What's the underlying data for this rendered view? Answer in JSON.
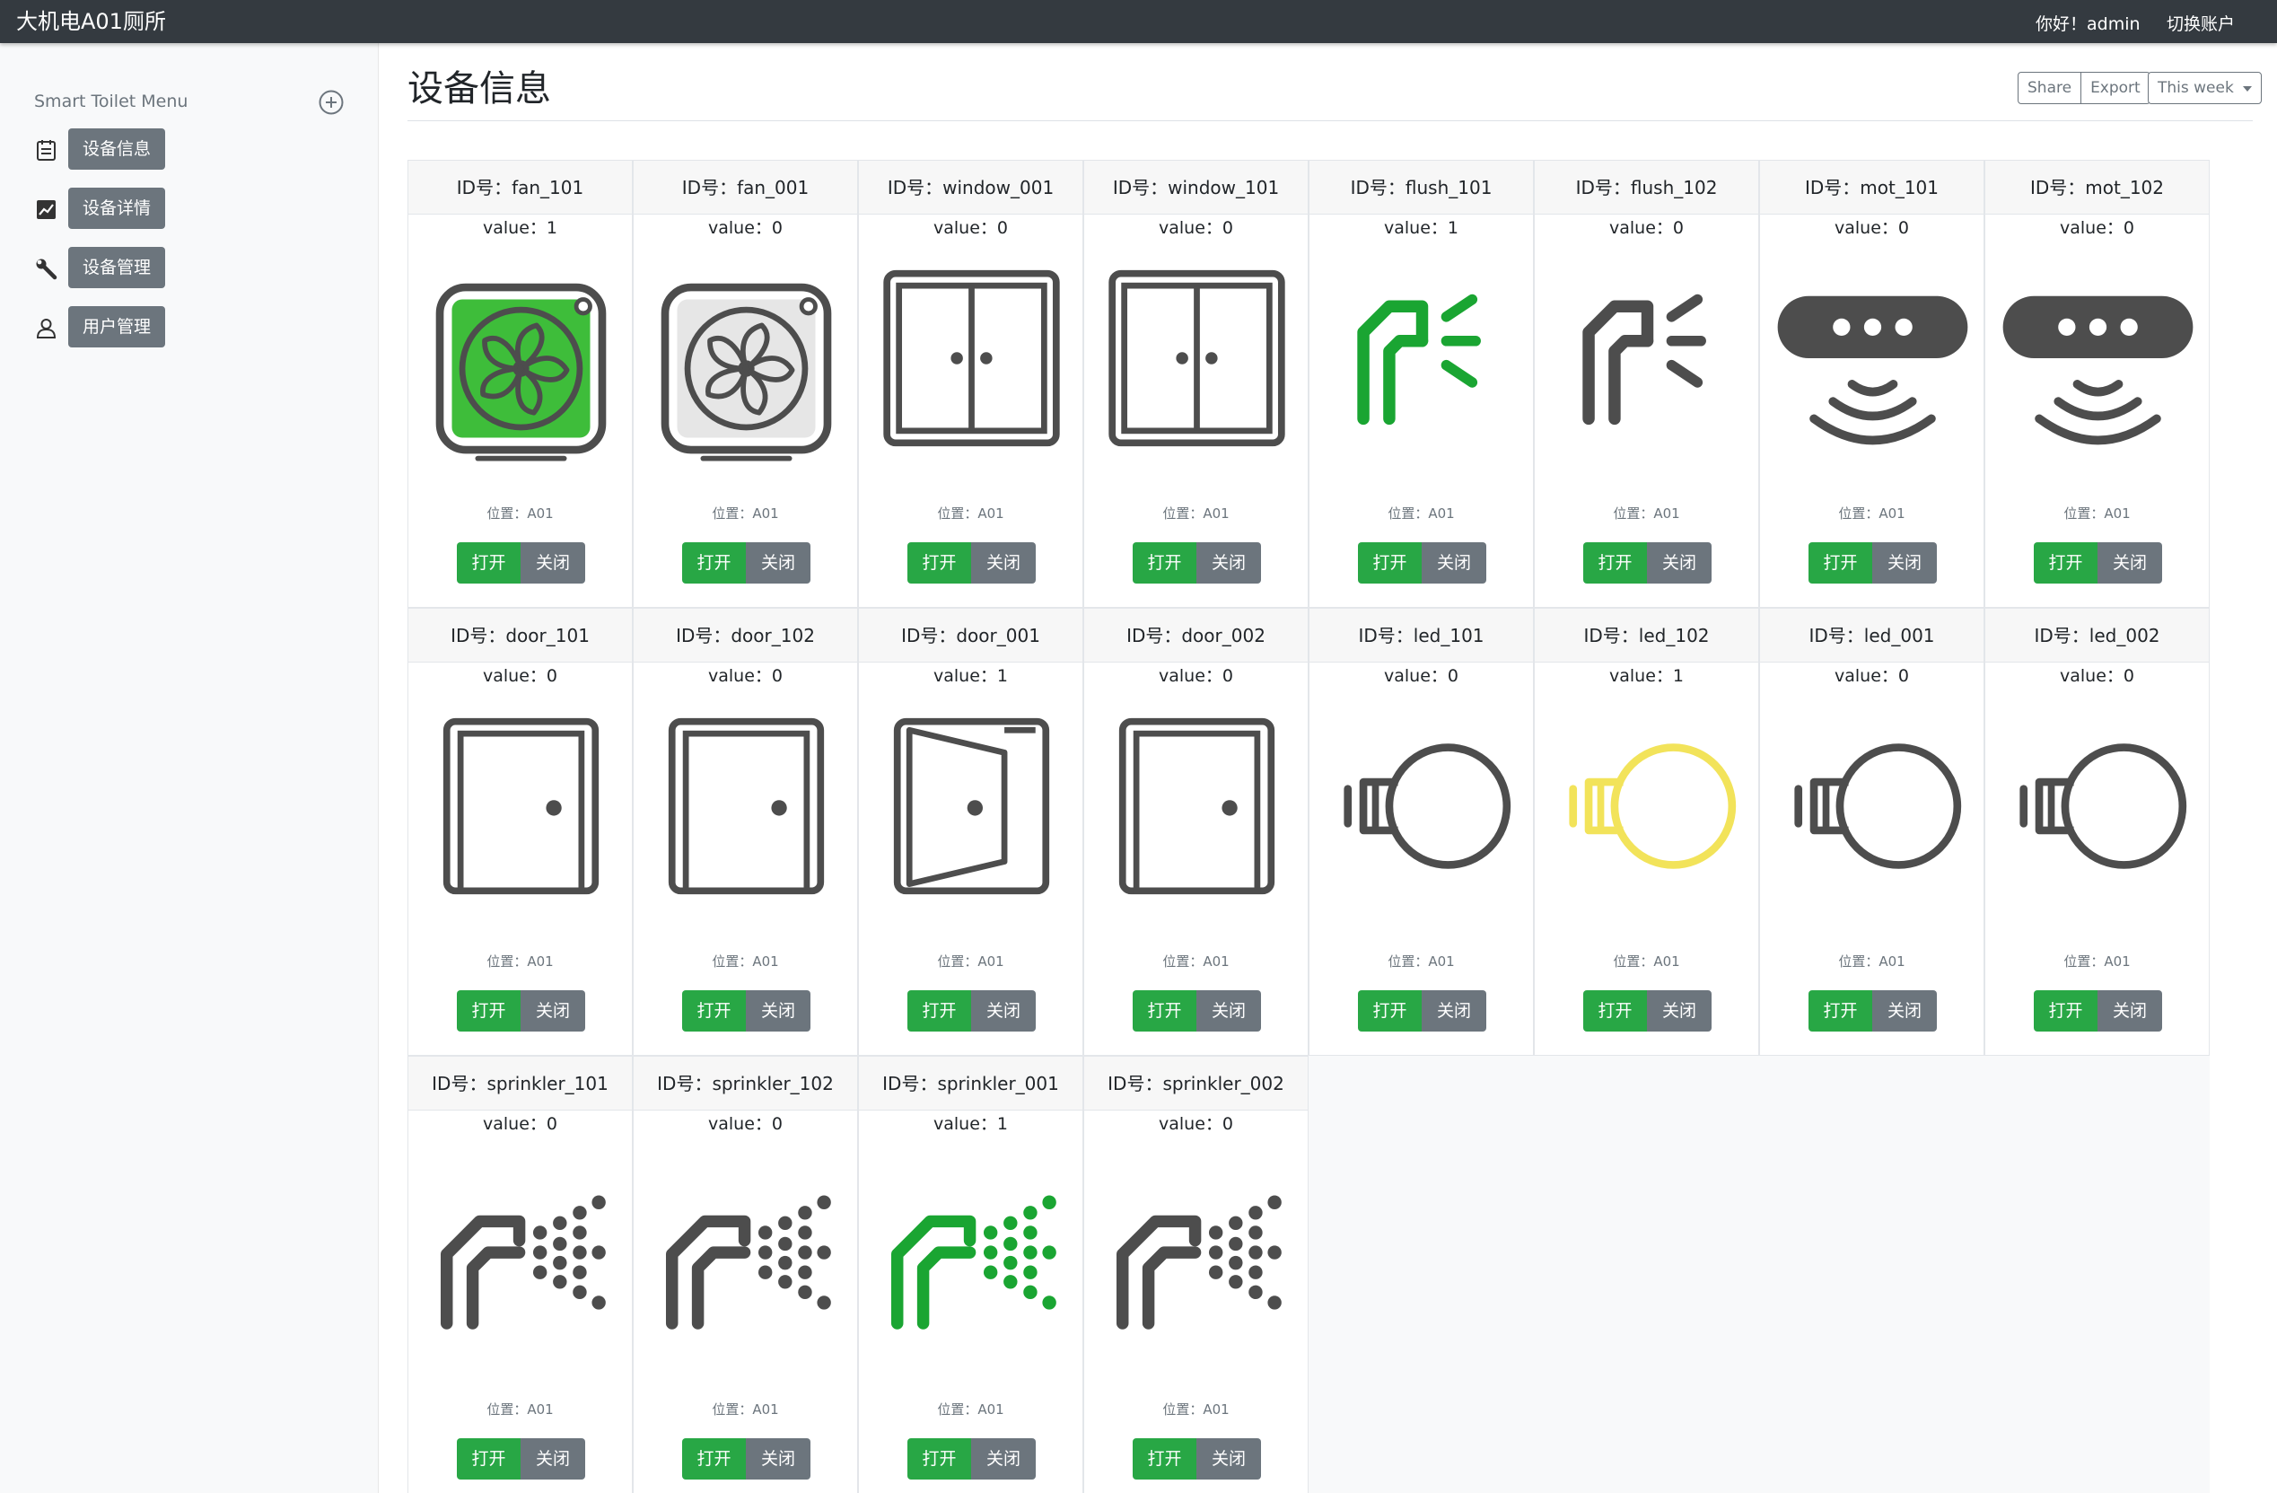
{
  "app": {
    "title": "大机电A01厕所"
  },
  "header": {
    "greeting": "你好！admin",
    "switch_account": "切换账户"
  },
  "sidebar": {
    "title": "Smart Toilet Menu",
    "add_icon": "plus-circle-icon",
    "items": [
      {
        "label": "设备信息",
        "icon": "calendar-icon"
      },
      {
        "label": "设备详情",
        "icon": "chart-icon"
      },
      {
        "label": "设备管理",
        "icon": "wrench-icon"
      },
      {
        "label": "用户管理",
        "icon": "user-icon"
      }
    ]
  },
  "main": {
    "title": "设备信息",
    "share_label": "Share",
    "export_label": "Export",
    "range_label": "This week"
  },
  "colors": {
    "active_green": "#1aa532",
    "led_yellow": "#f2e35a",
    "icon_gray": "#4d4d4d",
    "button_green": "#28a745",
    "button_gray": "#6c757d"
  },
  "devices": [
    {
      "id": "ID号：fan_101",
      "value": "value：1",
      "location": "位置：A01",
      "type": "fan",
      "on_label": "打开",
      "off_label": "关闭"
    },
    {
      "id": "ID号：fan_001",
      "value": "value：0",
      "location": "位置：A01",
      "type": "fan",
      "on_label": "打开",
      "off_label": "关闭"
    },
    {
      "id": "ID号：window_001",
      "value": "value：0",
      "location": "位置：A01",
      "type": "window",
      "on_label": "打开",
      "off_label": "关闭"
    },
    {
      "id": "ID号：window_101",
      "value": "value：0",
      "location": "位置：A01",
      "type": "window",
      "on_label": "打开",
      "off_label": "关闭"
    },
    {
      "id": "ID号：flush_101",
      "value": "value：1",
      "location": "位置：A01",
      "type": "flush",
      "on_label": "打开",
      "off_label": "关闭"
    },
    {
      "id": "ID号：flush_102",
      "value": "value：0",
      "location": "位置：A01",
      "type": "flush",
      "on_label": "打开",
      "off_label": "关闭"
    },
    {
      "id": "ID号：mot_101",
      "value": "value：0",
      "location": "位置：A01",
      "type": "motion",
      "on_label": "打开",
      "off_label": "关闭"
    },
    {
      "id": "ID号：mot_102",
      "value": "value：0",
      "location": "位置：A01",
      "type": "motion",
      "on_label": "打开",
      "off_label": "关闭"
    },
    {
      "id": "ID号：door_101",
      "value": "value：0",
      "location": "位置：A01",
      "type": "door",
      "on_label": "打开",
      "off_label": "关闭"
    },
    {
      "id": "ID号：door_102",
      "value": "value：0",
      "location": "位置：A01",
      "type": "door",
      "on_label": "打开",
      "off_label": "关闭"
    },
    {
      "id": "ID号：door_001",
      "value": "value：1",
      "location": "位置：A01",
      "type": "door",
      "on_label": "打开",
      "off_label": "关闭"
    },
    {
      "id": "ID号：door_002",
      "value": "value：0",
      "location": "位置：A01",
      "type": "door",
      "on_label": "打开",
      "off_label": "关闭"
    },
    {
      "id": "ID号：led_101",
      "value": "value：0",
      "location": "位置：A01",
      "type": "led",
      "on_label": "打开",
      "off_label": "关闭"
    },
    {
      "id": "ID号：led_102",
      "value": "value：1",
      "location": "位置：A01",
      "type": "led",
      "on_label": "打开",
      "off_label": "关闭"
    },
    {
      "id": "ID号：led_001",
      "value": "value：0",
      "location": "位置：A01",
      "type": "led",
      "on_label": "打开",
      "off_label": "关闭"
    },
    {
      "id": "ID号：led_002",
      "value": "value：0",
      "location": "位置：A01",
      "type": "led",
      "on_label": "打开",
      "off_label": "关闭"
    },
    {
      "id": "ID号：sprinkler_101",
      "value": "value：0",
      "location": "位置：A01",
      "type": "sprinkler",
      "on_label": "打开",
      "off_label": "关闭"
    },
    {
      "id": "ID号：sprinkler_102",
      "value": "value：0",
      "location": "位置：A01",
      "type": "sprinkler",
      "on_label": "打开",
      "off_label": "关闭"
    },
    {
      "id": "ID号：sprinkler_001",
      "value": "value：1",
      "location": "位置：A01",
      "type": "sprinkler",
      "on_label": "打开",
      "off_label": "关闭"
    },
    {
      "id": "ID号：sprinkler_002",
      "value": "value：0",
      "location": "位置：A01",
      "type": "sprinkler",
      "on_label": "打开",
      "off_label": "关闭"
    }
  ]
}
